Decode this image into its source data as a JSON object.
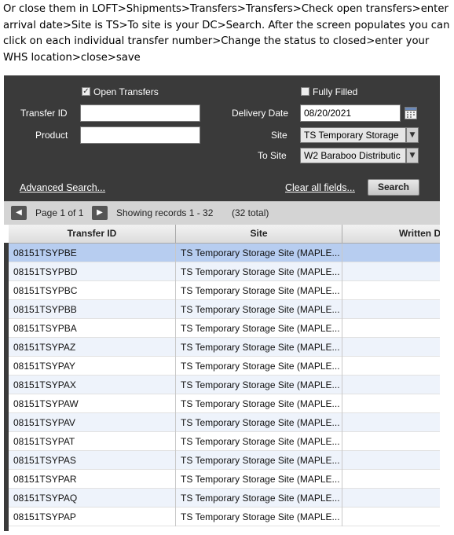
{
  "instructions": "Or  close them in LOFT>Shipments>Transfers>Transfers>Check open transfers>enter arrival date>Site is TS>To site is your DC>Search.  After the screen populates you can click on each individual transfer number>Change the status to closed>enter your WHS location>close>save",
  "filters": {
    "open_transfers_label": "Open Transfers",
    "open_transfers_checked": true,
    "fully_filled_label": "Fully Filled",
    "fully_filled_checked": false,
    "transfer_id_label": "Transfer ID",
    "transfer_id_value": "",
    "product_label": "Product",
    "product_value": "",
    "delivery_date_label": "Delivery Date",
    "delivery_date_value": "08/20/2021",
    "site_label": "Site",
    "site_value": "TS  Temporary Storage",
    "to_site_label": "To Site",
    "to_site_value": "W2  Baraboo Distributic"
  },
  "actions": {
    "advanced_search": "Advanced Search...",
    "clear_all": "Clear all fields...",
    "search": "Search"
  },
  "pager": {
    "page_text": "Page 1 of 1",
    "showing_text": "Showing records 1 - 32",
    "total_text": "(32 total)"
  },
  "grid": {
    "columns": [
      "Transfer ID",
      "Site",
      "Written D"
    ],
    "selected_row": 0,
    "rows": [
      {
        "id": "08151TSYPBE",
        "site": "TS  Temporary Storage Site  (MAPLE..."
      },
      {
        "id": "08151TSYPBD",
        "site": "TS  Temporary Storage Site  (MAPLE..."
      },
      {
        "id": "08151TSYPBC",
        "site": "TS  Temporary Storage Site  (MAPLE..."
      },
      {
        "id": "08151TSYPBB",
        "site": "TS  Temporary Storage Site  (MAPLE..."
      },
      {
        "id": "08151TSYPBA",
        "site": "TS  Temporary Storage Site  (MAPLE..."
      },
      {
        "id": "08151TSYPAZ",
        "site": "TS  Temporary Storage Site  (MAPLE..."
      },
      {
        "id": "08151TSYPAY",
        "site": "TS  Temporary Storage Site  (MAPLE..."
      },
      {
        "id": "08151TSYPAX",
        "site": "TS  Temporary Storage Site  (MAPLE..."
      },
      {
        "id": "08151TSYPAW",
        "site": "TS  Temporary Storage Site  (MAPLE..."
      },
      {
        "id": "08151TSYPAV",
        "site": "TS  Temporary Storage Site  (MAPLE..."
      },
      {
        "id": "08151TSYPAT",
        "site": "TS  Temporary Storage Site  (MAPLE..."
      },
      {
        "id": "08151TSYPAS",
        "site": "TS  Temporary Storage Site  (MAPLE..."
      },
      {
        "id": "08151TSYPAR",
        "site": "TS  Temporary Storage Site  (MAPLE..."
      },
      {
        "id": "08151TSYPAQ",
        "site": "TS  Temporary Storage Site  (MAPLE..."
      },
      {
        "id": "08151TSYPAP",
        "site": "TS  Temporary Storage Site  (MAPLE..."
      }
    ]
  },
  "colors": {
    "panel_bg": "#3a3a3a",
    "selected_row": "#b7cdf0",
    "alt_row": "#eef3fb"
  }
}
